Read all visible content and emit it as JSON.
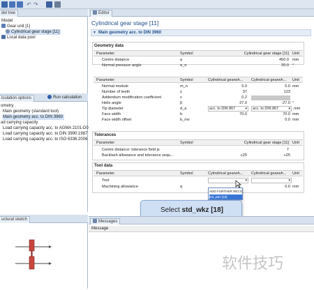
{
  "toolbar": {
    "icons": [
      "app-icon",
      "save-icon",
      "save-as-icon",
      "undo-icon",
      "redo-icon",
      "report-icon",
      "print-icon"
    ]
  },
  "left_top": {
    "tab_label": "del tree",
    "tree": [
      {
        "label": "Model",
        "indent": 0
      },
      {
        "label": "Gear unit [1]",
        "indent": 1
      },
      {
        "label": "Cylindrical gear stage [11]",
        "indent": 2,
        "selected": true
      },
      {
        "label": "Local data pool",
        "indent": 1
      }
    ]
  },
  "left_middle": {
    "tab_label": "lculation options",
    "run_label": "Run calculation",
    "items": [
      "ometry",
      "Main geometry (standard tool)",
      "Main geometry acc. to DIN 3960",
      "ad carrying capacity",
      "Load carrying capacity acc. to AGMA 2101-D04",
      "Load carrying capacity acc. to DIN 3990:1987",
      "Load carrying capacity acc. to ISO 6336:2006"
    ],
    "selected_index": 2
  },
  "left_bottom": {
    "tab_label": "uctural sketch"
  },
  "editor": {
    "tab_label": "Editor",
    "title": "Cylindrical gear stage [11]",
    "section_title": "Main geometry acc. to DIN 3960",
    "geometry": {
      "title": "Geometry data",
      "headers": [
        "Parameter",
        "Symbol",
        "Cylindrical gear stage [11]",
        "Unit"
      ],
      "rows": [
        {
          "param": "Centre distance",
          "symbol": "a",
          "value": "450.0",
          "unit": "mm"
        },
        {
          "param": "Normal pressure angle",
          "symbol": "α_n",
          "value": "20.0",
          "unit": "°"
        }
      ]
    },
    "gears": {
      "headers": [
        "Parameter",
        "Symbol",
        "Cylindrical gearwh...",
        "Cylindrical gearwh...",
        "Unit"
      ],
      "rows": [
        {
          "param": "Normal module",
          "symbol": "m_n",
          "v1": "5.0",
          "v2": "5.0",
          "unit": "mm"
        },
        {
          "param": "Number of teeth",
          "symbol": "z",
          "v1": "37",
          "v2": "123",
          "unit": ""
        },
        {
          "param": "Addendum modification coefficient",
          "symbol": "x",
          "v1": "0.2",
          "v2": "",
          "unit": ""
        },
        {
          "param": "Helix angle",
          "symbol": "β",
          "v1": "27.0",
          "v2": "-27.0",
          "unit": "°"
        },
        {
          "param": "Tip diameter",
          "symbol": "d_a",
          "v1": "acc. to DIN 867",
          "v2": "acc. to DIN 867",
          "unit": "mm"
        },
        {
          "param": "Face width",
          "symbol": "b",
          "v1": "70.0",
          "v2": "70.0",
          "unit": "mm"
        },
        {
          "param": "Face width offset",
          "symbol": "b_mv",
          "v1": "",
          "v2": "0.0",
          "unit": "mm"
        }
      ]
    },
    "tolerances": {
      "title": "Tolerances",
      "headers": [
        "Parameter",
        "Symbol",
        "Cylindrical gear stage [11]",
        "Unit"
      ],
      "rows": [
        {
          "param": "Centre distance: tolerance field js",
          "symbol": "",
          "value": "7",
          "unit": ""
        },
        {
          "param": "Backlash allowance and tolerance sequ...",
          "symbol": "",
          "v1": "c25",
          "value": "c25",
          "unit": ""
        }
      ]
    },
    "tool": {
      "title": "Tool data",
      "headers": [
        "Parameter",
        "Symbol",
        "Cylindrical gearwh...",
        "Cylindrical gearwh...",
        "Unit"
      ],
      "rows": [
        {
          "param": "Tool",
          "symbol": "",
          "v1": "",
          "v2": "",
          "unit": ""
        },
        {
          "param": "Machining allowance",
          "symbol": "q",
          "v1": "",
          "v2": "0.0",
          "unit": "mm"
        }
      ],
      "dropdown_options": [
        "ADD FURTHER RECORDS",
        "std_wkz [18]"
      ],
      "highlighted_option": 1
    }
  },
  "callout": {
    "prefix": "Select ",
    "bold": "std_wkz [18]"
  },
  "messages": {
    "tab_label": "Messages",
    "column_header": "Message"
  },
  "watermark": "软件技巧",
  "colors": {
    "toolbar_bg": "#dde6f0",
    "panel_header": "#d8e2ee",
    "section_blue": "#1f4e8c",
    "callout_bg": "#cfe0f5",
    "selection": "#cfe0f5",
    "highlight": "#3875d7"
  }
}
